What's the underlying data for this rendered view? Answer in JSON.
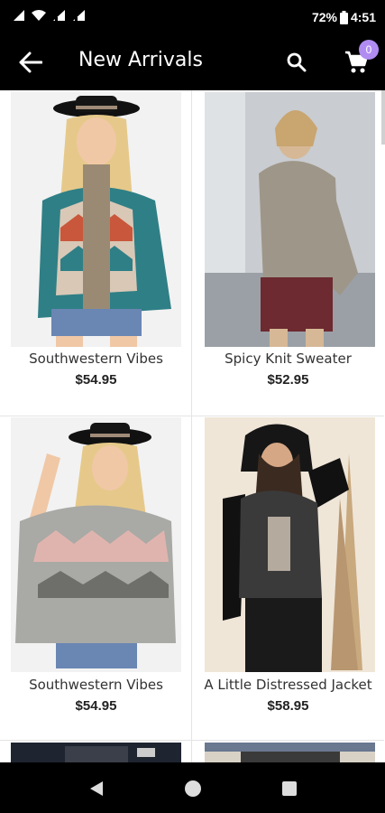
{
  "status_bar": {
    "battery_percent": "72%",
    "time": "4:51",
    "icons": [
      "signal-icon",
      "wifi-icon",
      "signal-icon",
      "signal-icon",
      "battery-icon"
    ]
  },
  "app_bar": {
    "title": "New Arrivals",
    "cart_count": "0",
    "badge_color": "#b08cf2"
  },
  "products": [
    {
      "name": "Southwestern Vibes",
      "price": "$54.95"
    },
    {
      "name": "Spicy Knit Sweater",
      "price": "$52.95"
    },
    {
      "name": "Southwestern Vibes",
      "price": "$54.95"
    },
    {
      "name": "A Little Distressed Jacket",
      "price": "$58.95"
    }
  ],
  "nav_bar": {
    "buttons": [
      "back-triangle-icon",
      "home-circle-icon",
      "recents-square-icon"
    ]
  }
}
